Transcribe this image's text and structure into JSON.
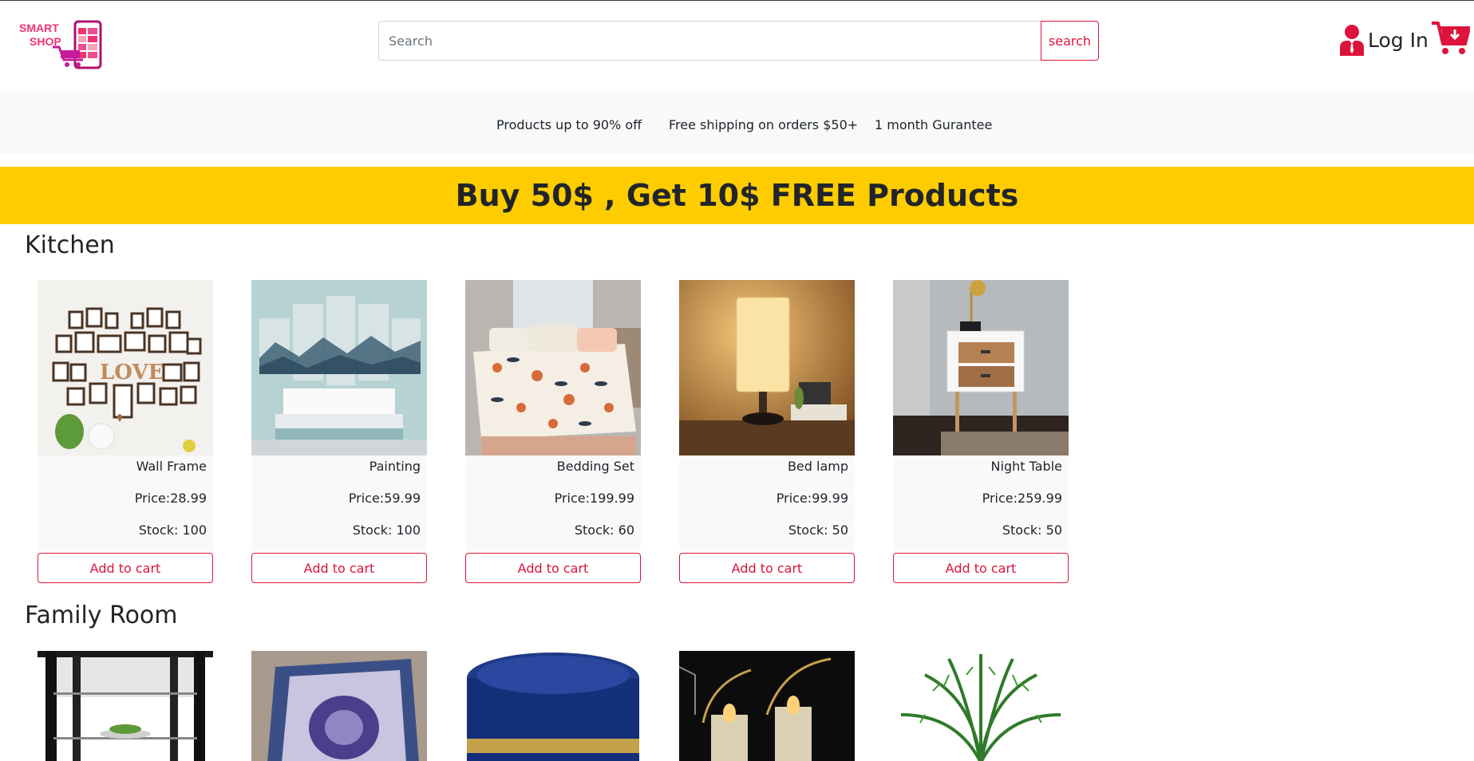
{
  "header": {
    "logo_text_line1": "SMART",
    "logo_text_line2": "SHOP",
    "search_placeholder": "Search",
    "search_button": "search",
    "login_label": "Log In",
    "brand_color": "#dc143c"
  },
  "infobar": {
    "items": [
      "Products up to 90% off",
      "Free shipping on orders $50+",
      "1 month Gurantee"
    ]
  },
  "promo": {
    "text": "Buy 50$ , Get 10$ FREE Products",
    "background": "#ffcc00"
  },
  "sections": [
    {
      "title": "Kitchen",
      "products": [
        {
          "name": "Wall Frame",
          "price": "Price:28.99",
          "stock": "Stock: 100",
          "button": "Add to cart",
          "image": "wall-frame-image"
        },
        {
          "name": "Painting",
          "price": "Price:59.99",
          "stock": "Stock: 100",
          "button": "Add to cart",
          "image": "painting-image"
        },
        {
          "name": "Bedding Set",
          "price": "Price:199.99",
          "stock": "Stock: 60",
          "button": "Add to cart",
          "image": "bedding-set-image"
        },
        {
          "name": "Bed lamp",
          "price": "Price:99.99",
          "stock": "Stock: 50",
          "button": "Add to cart",
          "image": "bed-lamp-image"
        },
        {
          "name": "Night Table",
          "price": "Price:259.99",
          "stock": "Stock: 50",
          "button": "Add to cart",
          "image": "night-table-image"
        }
      ]
    },
    {
      "title": "Family Room",
      "products": [
        {
          "image": "shelf-image"
        },
        {
          "image": "rug-image"
        },
        {
          "image": "ottoman-image"
        },
        {
          "image": "candle-holder-image"
        },
        {
          "image": "palm-plant-image"
        }
      ]
    }
  ]
}
